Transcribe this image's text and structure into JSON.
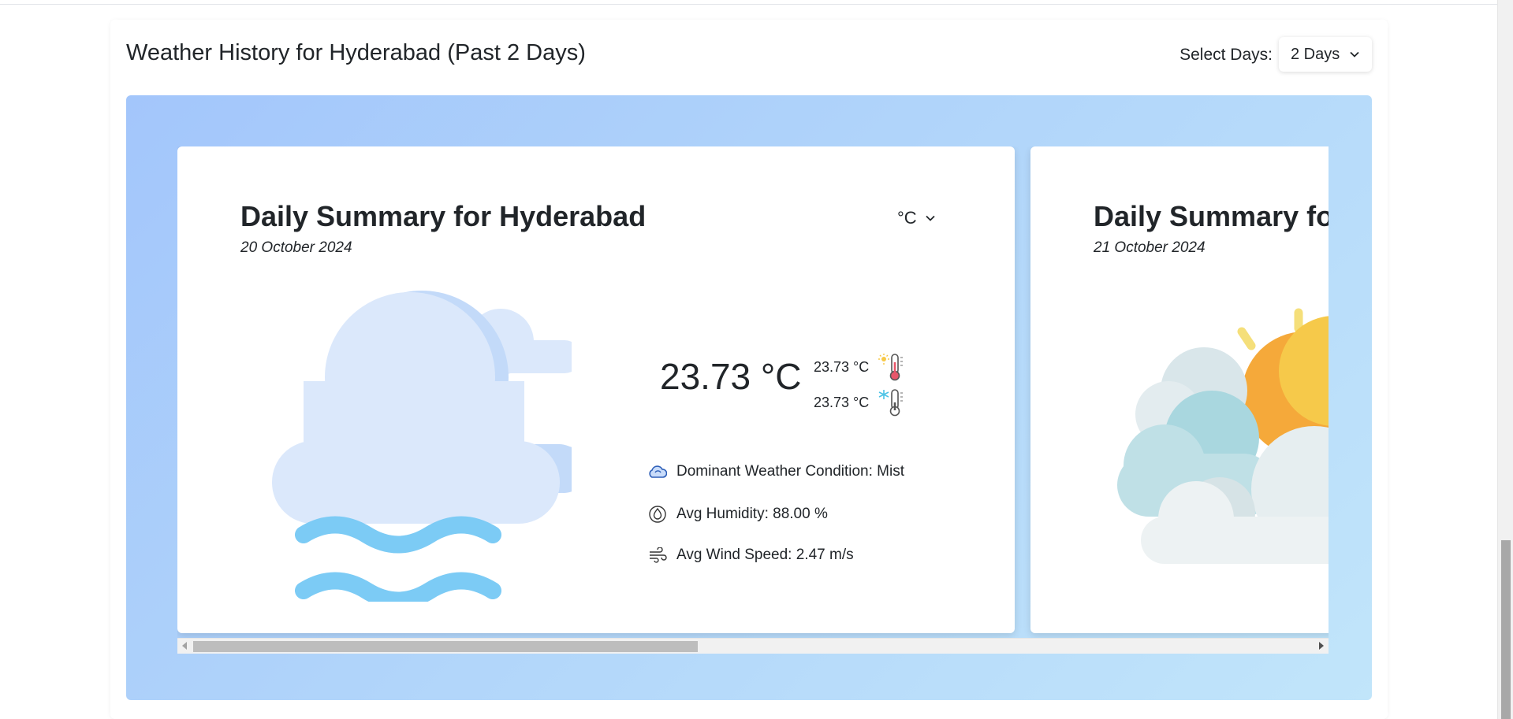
{
  "header": {
    "title": "Weather History for Hyderabad (Past 2 Days)",
    "days_label": "Select Days:",
    "days_value": "2 Days"
  },
  "cards": [
    {
      "title": "Daily Summary for Hyderabad",
      "date": "20 October 2024",
      "unit": "°C",
      "icon": "mist-cloud-icon",
      "avg_temp": "23.73 °C",
      "max_temp": "23.73 °C",
      "min_temp": "23.73 °C",
      "condition": "Dominant Weather Condition: Mist",
      "humidity": "Avg Humidity: 88.00 %",
      "wind": "Avg Wind Speed: 2.47 m/s"
    },
    {
      "title": "Daily Summary for Hyderabad",
      "date": "21 October 2024",
      "icon": "partly-cloudy-sun-icon"
    }
  ],
  "colors": {
    "gradient_start": "#a3c6fb",
    "gradient_end": "#c1e5fa",
    "mist_waves": "#7ccbf5",
    "cloud": "#dbe8fb",
    "sun": "#f7b33c"
  }
}
